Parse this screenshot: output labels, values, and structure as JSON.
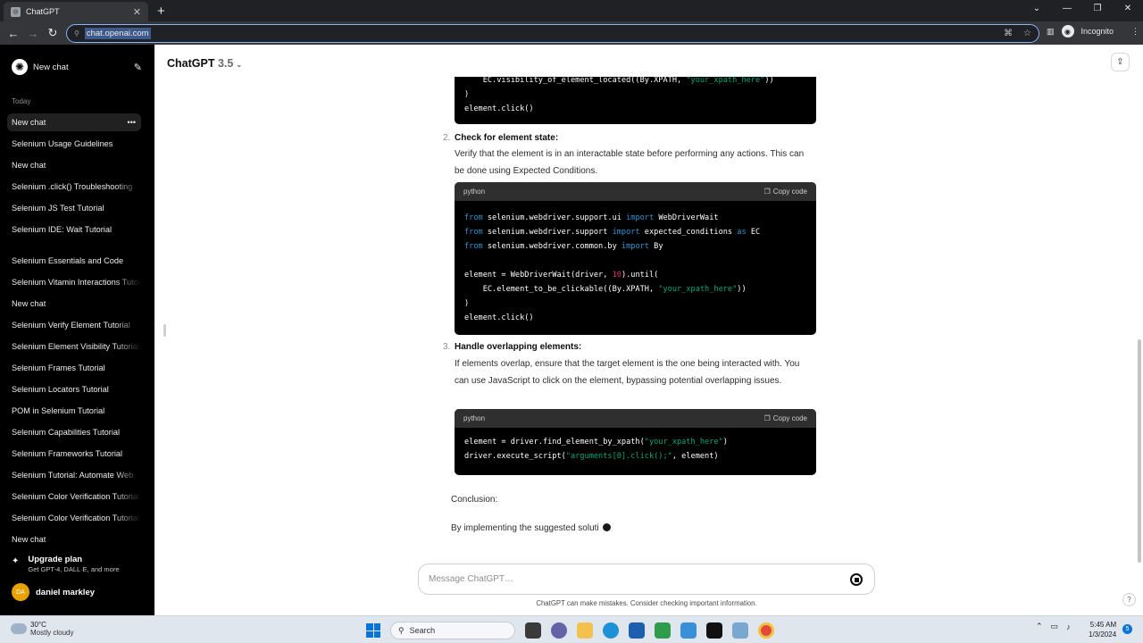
{
  "browser": {
    "tab_title": "ChatGPT",
    "url": "chat.openai.com",
    "profile_label": "Incognito",
    "new_tab_glyph": "+",
    "close_glyph": "✕"
  },
  "sidebar": {
    "new_chat": "New chat",
    "section_today": "Today",
    "items": [
      "New chat",
      "Selenium Usage Guidelines",
      "New chat",
      "Selenium .click() Troubleshooting",
      "Selenium JS Test Tutorial",
      "Selenium IDE: Wait Tutorial",
      "Selenium Essentials and Code",
      "Selenium Vitamin Interactions Tutorial",
      "New chat",
      "Selenium Verify Element Tutorial",
      "Selenium Element Visibility Tutorial",
      "Selenium Frames Tutorial",
      "Selenium Locators Tutorial",
      "POM in Selenium Tutorial",
      "Selenium Capabilities Tutorial",
      "Selenium Frameworks Tutorial",
      "Selenium Tutorial: Automate Web",
      "Selenium Color Verification Tutorial",
      "Selenium Color Verification Tutorial",
      "New chat"
    ],
    "upgrade_title": "Upgrade plan",
    "upgrade_sub": "Get GPT-4, DALL·E, and more",
    "user_initials": "DA",
    "user_name": "daniel markley"
  },
  "header": {
    "model_name": "ChatGPT",
    "model_version": "3.5"
  },
  "conversation": {
    "code_lang": "python",
    "copy_label": "Copy code",
    "code1_tail": [
      "    EC.visibility_of_element_located((By.XPATH, \"your_xpath_here\"))",
      ")",
      "element.click()"
    ],
    "item2_number": "2.",
    "item2_title": "Check for element state:",
    "item2_text": "Verify that the element is in an interactable state before performing any actions. This can be done using Expected Conditions.",
    "item3_number": "3.",
    "item3_title": "Handle overlapping elements:",
    "item3_text": "If elements overlap, ensure that the target element is the one being interacted with. You can use JavaScript to click on the element, bypassing potential overlapping issues.",
    "conclusion": "Conclusion:",
    "streaming_text": "By implementing the suggested soluti"
  },
  "composer": {
    "placeholder": "Message ChatGPT…",
    "disclaimer": "ChatGPT can make mistakes. Consider checking important information."
  },
  "taskbar": {
    "temperature": "30°C",
    "weather": "Mostly cloudy",
    "search_label": "Search",
    "time": "5:45 AM",
    "date": "1/3/2024",
    "notification_count": "5"
  },
  "colors": {
    "sidebar_bg": "#000000",
    "code_keyword": "#2e95d3",
    "code_string": "#00a67d",
    "code_number": "#df3079",
    "avatar": "#e8a200",
    "omnibox_focus": "#8ab4f8"
  }
}
